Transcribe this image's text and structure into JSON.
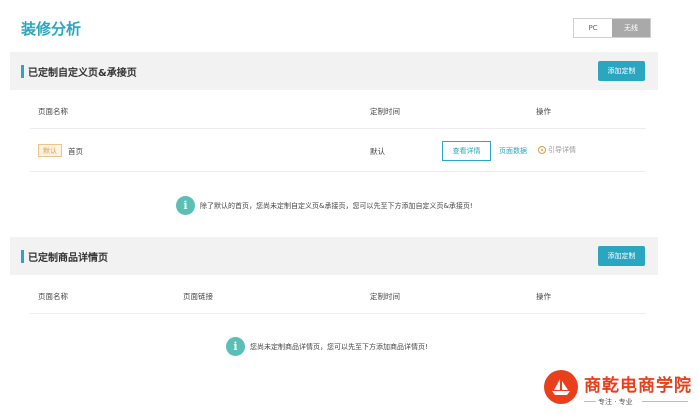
{
  "page": {
    "title": "装修分析"
  },
  "mode_toggle": {
    "pc_label": "PC",
    "wireless_label": "无线",
    "selected": "无线"
  },
  "custom_pages": {
    "title": "已定制自定义页&承接页",
    "add_button": "添加定制",
    "columns": [
      "页面名称",
      "定制时间",
      "操作"
    ],
    "rows": [
      {
        "badge": "默认",
        "name": "首页",
        "time": "默认",
        "view_detail": "查看详情",
        "page_data": "页面数据",
        "guide_detail": "引导详情"
      }
    ],
    "notice": "除了默认的首页，您尚未定制自定义页&承接页，您可以先至下方添加自定义页&承接页!"
  },
  "product_pages": {
    "title": "已定制商品详情页",
    "add_button": "添加定制",
    "columns": [
      "页面名称",
      "页面链接",
      "定制时间",
      "操作"
    ],
    "notice": "您尚未定制商品详情页，您可以先至下方添加商品详情页!"
  },
  "watermark": {
    "name": "商乾电商学院",
    "slogan": "专注 · 专业"
  },
  "colors": {
    "accent": "#2aa6c0",
    "badge": "#e39a3b",
    "info_icon": "#5bbfb5",
    "watermark": "#e8401c"
  },
  "icons": {
    "info": "info-icon",
    "guide": "radio-icon"
  }
}
